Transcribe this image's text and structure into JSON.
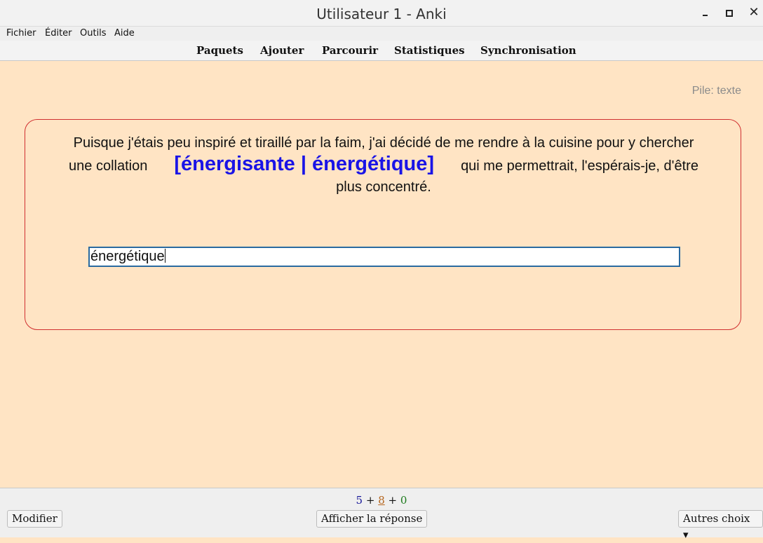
{
  "window": {
    "title": "Utilisateur 1 - Anki"
  },
  "menu": [
    "Fichier",
    "Éditer",
    "Outils",
    "Aide"
  ],
  "toolbar": [
    "Paquets",
    "Ajouter",
    "Parcourir",
    "Statistiques",
    "Synchronisation"
  ],
  "deck_label": "Pile: texte",
  "card": {
    "text_before": "Puisque j'étais peu inspiré et tiraillé par la faim, j'ai décidé de me rendre à la cuisine pour y chercher une collation",
    "cloze": "[énergisante | énergétique]",
    "text_after": "qui me permettrait, l'espérais-je, d'être plus concentré.",
    "answer_value": "énergétique"
  },
  "counts": {
    "new": "5",
    "learn": "8",
    "review": "0",
    "sep": "+"
  },
  "buttons": {
    "edit": "Modifier",
    "show_answer": "Afficher la réponse",
    "more": "Autres choix ▾"
  },
  "colors": {
    "new": "#1a1a9a",
    "learn": "#b5651d",
    "review": "#1b7a1b",
    "cloze": "#1a14e6"
  }
}
